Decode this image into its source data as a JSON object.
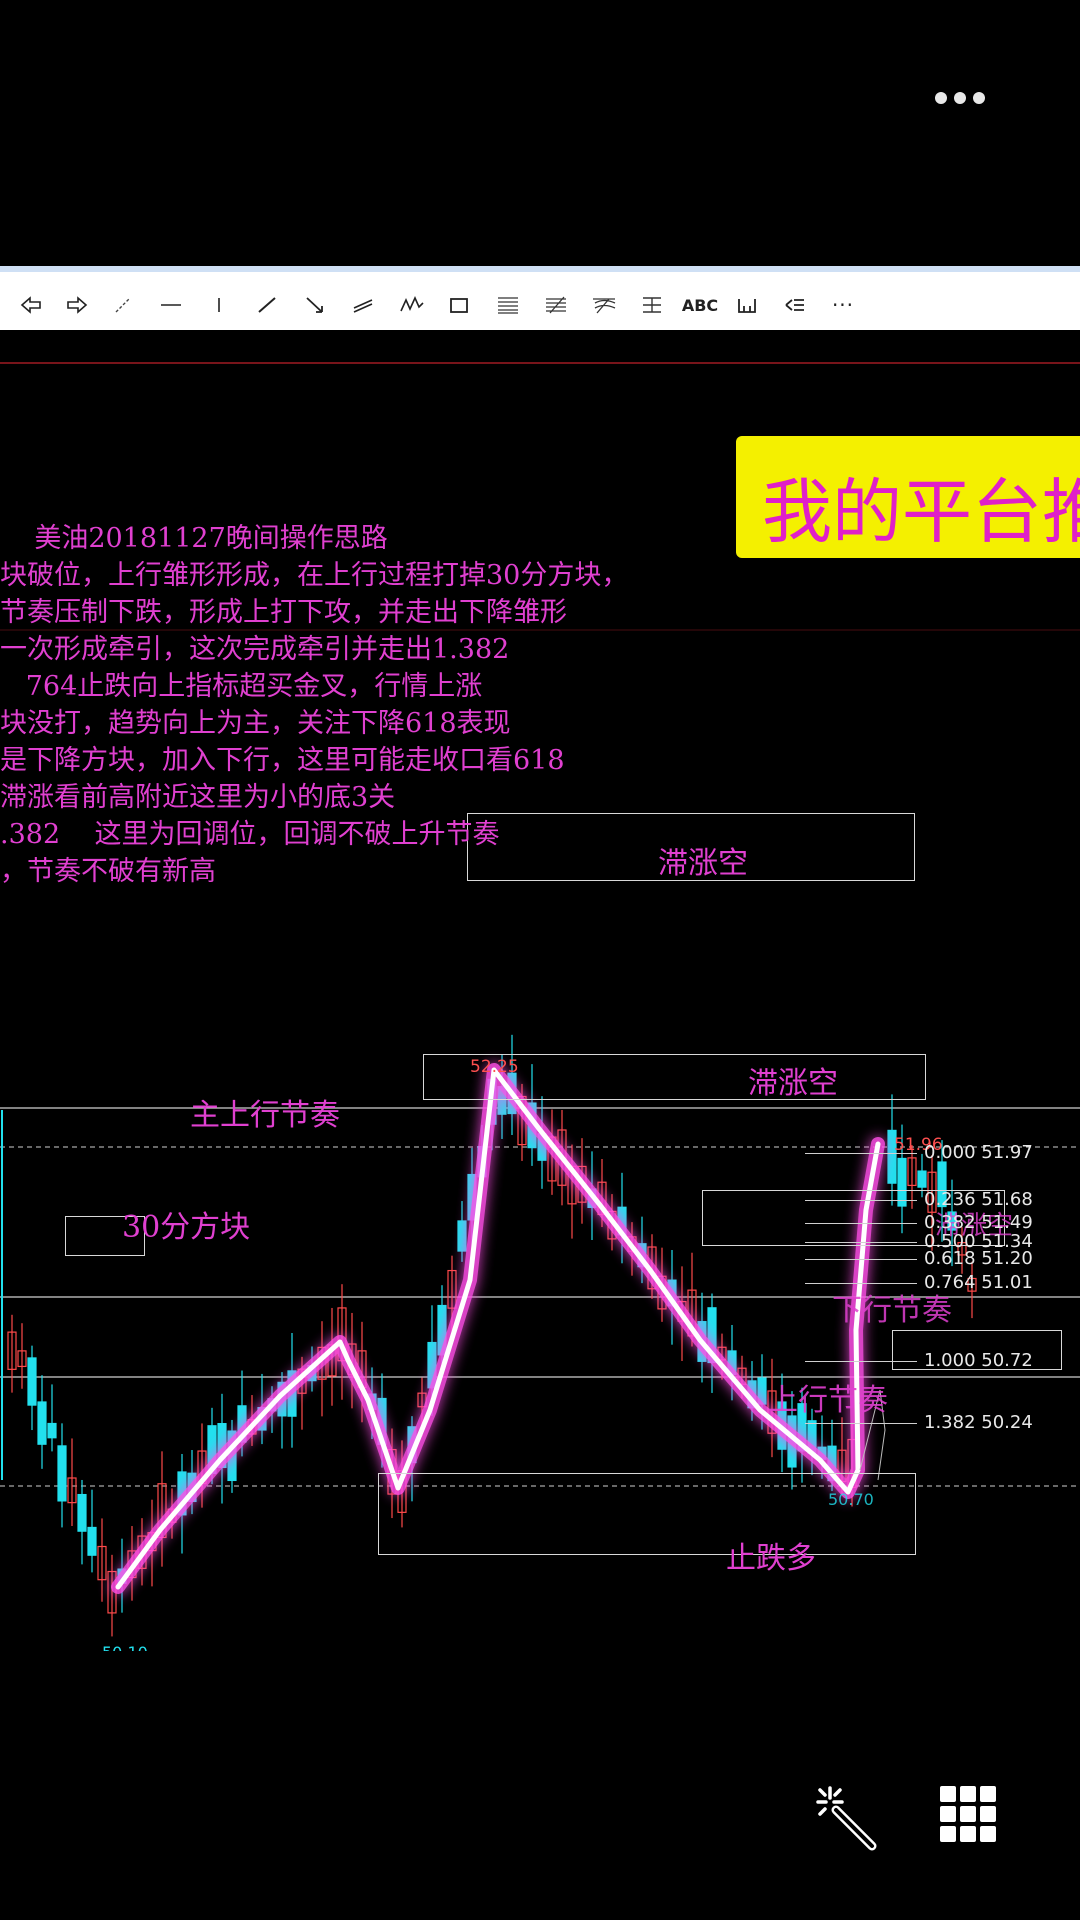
{
  "menu_icon": "more-horizontal-icon",
  "toolbar": {
    "items": [
      "arrow-left-icon",
      "arrow-right-icon",
      "dash-line-icon",
      "horizontal-line-icon",
      "vertical-line-icon",
      "trend-line-icon",
      "arrow-line-icon",
      "parallel-channel-icon",
      "zigzag-icon",
      "rectangle-icon",
      "fib-retracement-icon",
      "fib-fan-icon",
      "fib-arc-icon",
      "fib-timezone-icon",
      "text-tool-icon",
      "cycle-lines-icon",
      "gann-icon",
      "more-icon"
    ],
    "text_label": "ABC",
    "more_label": "···"
  },
  "annotation": {
    "lines": [
      "    美油20181127晚间操作思路",
      "块破位，上行雏形形成，在上行过程打掉30分方块，",
      "节奏压制下跌，形成上打下攻，并走出下降雏形",
      "一次形成牵引，这次完成牵引并走出1.382",
      "   764止跌向上指标超买金叉，行情上涨",
      "块没打，趋势向上为主，关注下降618表现",
      "是下降方块，加入下行，这里可能走收口看618",
      "滞涨看前高附近这里为小的底3关",
      ".382    这里为回调位，回调不破上升节奏",
      "，节奏不破有新高"
    ]
  },
  "banner": {
    "text": "我的平台推"
  },
  "labels": {
    "stall_short_1": "滞涨空",
    "stall_short_2": "滞涨空",
    "main_up_rhythm": "主上行节奏",
    "block_30min": "30分方块",
    "stop_fall_long": "止跌多",
    "up_rhythm": "上行节奏",
    "down_rhythm": "下行节奏",
    "stall_short_3": "滞涨空"
  },
  "price_labels": {
    "high": "52.25",
    "low": "50.10",
    "recent_high": "51.96",
    "recent_low": "50.70"
  },
  "fib_levels": [
    {
      "ratio": "0.000",
      "price": "51.97"
    },
    {
      "ratio": "0.236",
      "price": "51.68"
    },
    {
      "ratio": "0.382",
      "price": "51.49"
    },
    {
      "ratio": "0.500",
      "price": "51.34"
    },
    {
      "ratio": "0.618",
      "price": "51.20"
    },
    {
      "ratio": "0.764",
      "price": "51.01"
    },
    {
      "ratio": "1.000",
      "price": "50.72"
    },
    {
      "ratio": "1.382",
      "price": "50.24"
    }
  ],
  "colors": {
    "up_candle": "#ff4a4a",
    "down_candle": "#22e0ee",
    "annotation": "#e040d0",
    "glow": "#ff40e0",
    "banner": "#f4f000"
  },
  "bottom_icons": [
    "magic-wand-icon",
    "grid-menu-icon"
  ]
}
